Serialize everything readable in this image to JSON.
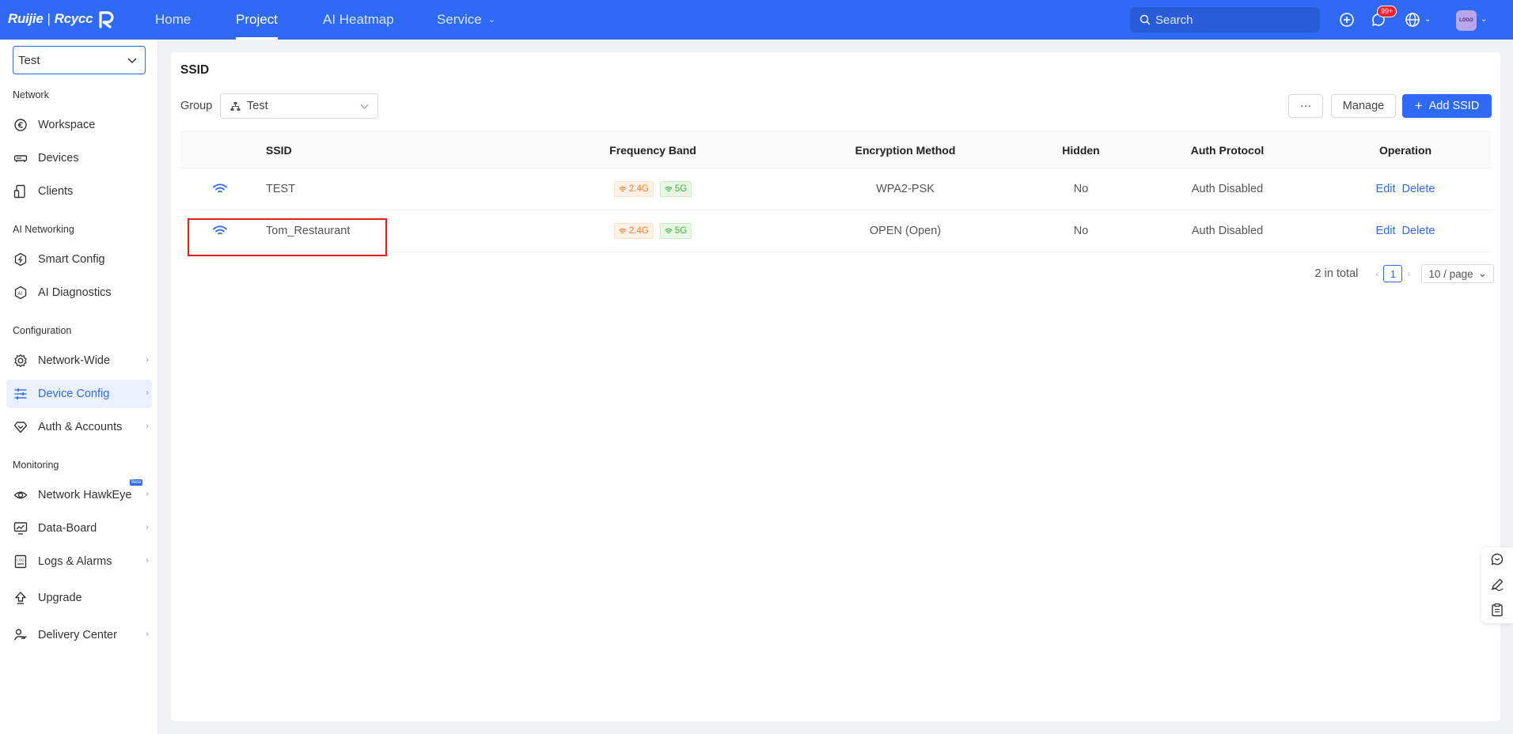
{
  "topbar": {
    "brand_left": "Ruijie",
    "brand_sep": "|",
    "brand_right": "Rcycc",
    "nav": [
      {
        "label": "Home"
      },
      {
        "label": "Project"
      },
      {
        "label": "AI Heatmap"
      },
      {
        "label": "Service"
      }
    ],
    "search_placeholder": "Search",
    "messages_badge": "99+",
    "avatar_text": "LOGO"
  },
  "sidebar": {
    "project_select": "Test",
    "sections": {
      "network": "Network",
      "ai_networking": "AI Networking",
      "configuration": "Configuration",
      "monitoring": "Monitoring"
    },
    "items": {
      "workspace": "Workspace",
      "devices": "Devices",
      "clients": "Clients",
      "smart_config": "Smart Config",
      "ai_diagnostics": "AI Diagnostics",
      "network_wide": "Network-Wide",
      "device_config": "Device Config",
      "auth_accounts": "Auth & Accounts",
      "network_hawkeye": "Network HawkEye",
      "hawkeye_badge": "Beta",
      "data_board": "Data-Board",
      "logs_alarms": "Logs & Alarms",
      "upgrade": "Upgrade",
      "delivery_center": "Delivery Center"
    }
  },
  "main": {
    "title": "SSID",
    "group_label": "Group",
    "group_value": "Test",
    "more_label": "···",
    "manage_label": "Manage",
    "add_label": "Add SSID",
    "columns": {
      "ssid": "SSID",
      "band": "Frequency Band",
      "encryption": "Encryption Method",
      "hidden": "Hidden",
      "auth": "Auth Protocol",
      "operation": "Operation"
    },
    "rows": [
      {
        "ssid": "TEST",
        "band_24": "2.4G",
        "band_5": "5G",
        "encryption": "WPA2-PSK",
        "hidden": "No",
        "auth": "Auth Disabled",
        "edit": "Edit",
        "delete": "Delete"
      },
      {
        "ssid": "Tom_Restaurant",
        "band_24": "2.4G",
        "band_5": "5G",
        "encryption": "OPEN (Open)",
        "hidden": "No",
        "auth": "Auth Disabled",
        "edit": "Edit",
        "delete": "Delete"
      }
    ],
    "pagination": {
      "total": "2 in total",
      "current_page": "1",
      "page_size": "10 / page"
    }
  },
  "colors": {
    "accent": "#2f6af5",
    "band_24": "#fa7d2d",
    "band_5": "#3bb33b",
    "highlight": "#e31c1c"
  }
}
